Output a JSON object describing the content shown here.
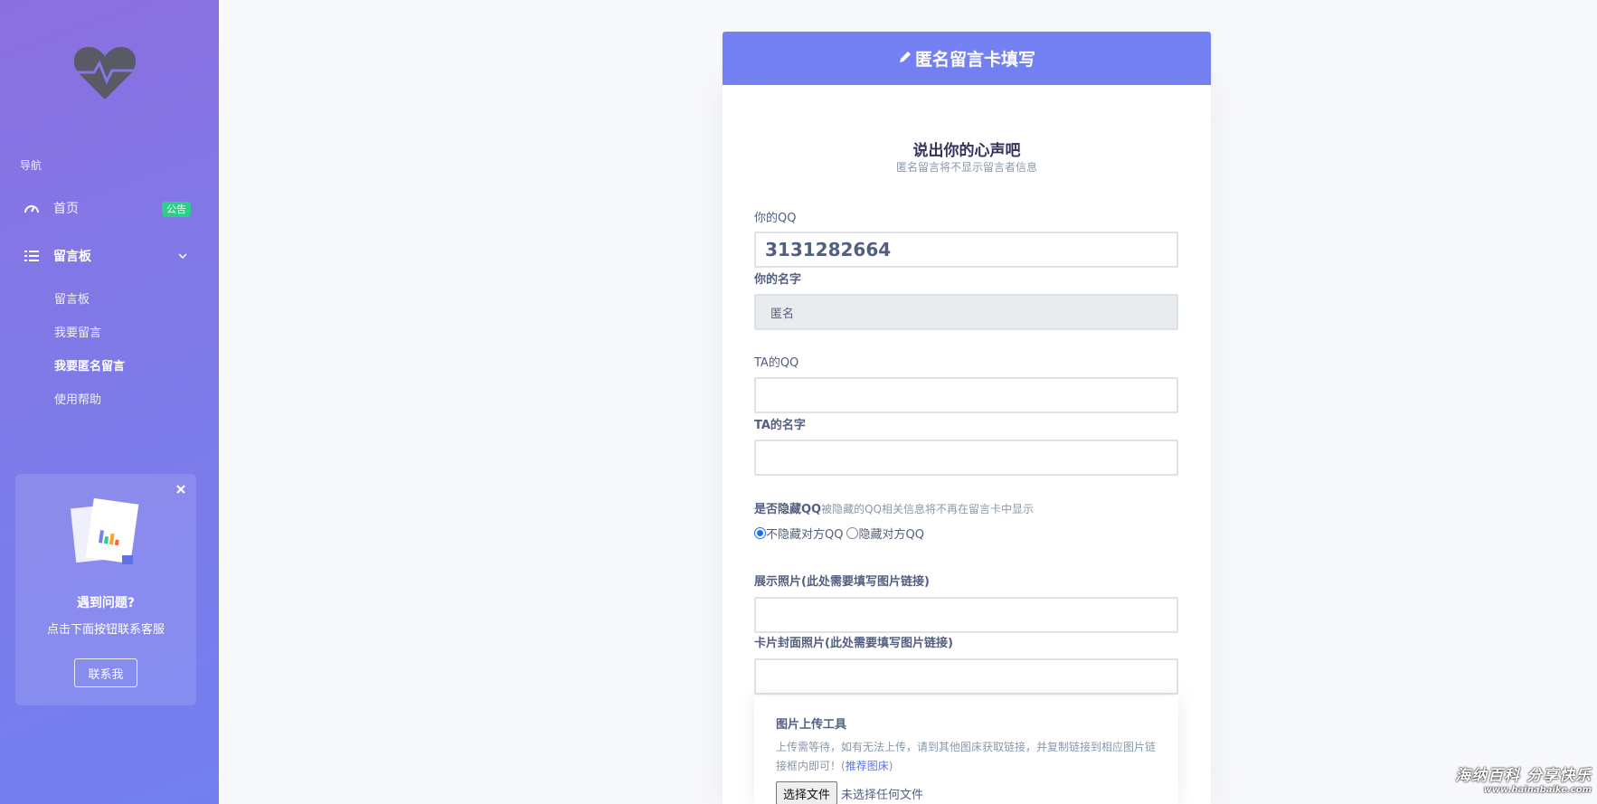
{
  "sidebar": {
    "nav_heading": "导航",
    "items": [
      {
        "label": "首页",
        "badge": "公告"
      },
      {
        "label": "留言板"
      }
    ],
    "sub_items": [
      "留言板",
      "我要留言",
      "我要匿名留言",
      "使用帮助"
    ],
    "help": {
      "title": "遇到问题?",
      "subtitle": "点击下面按钮联系客服",
      "button": "联系我"
    }
  },
  "card": {
    "header_title": "匿名留言卡填写",
    "form_title": "说出你的心声吧",
    "form_subtitle": "匿名留言将不显示留言者信息",
    "fields": {
      "your_qq_label": "你的QQ",
      "your_qq_value": "3131282664",
      "your_name_label": "你的名字",
      "your_name_value": "匿名",
      "ta_qq_label": "TA的QQ",
      "ta_name_label": "TA的名字",
      "hide_qq_label": "是否隐藏QQ",
      "hide_qq_hint": "被隐藏的QQ相关信息将不再在留言卡中显示",
      "radio_show": "不隐藏对方QQ",
      "radio_hide": "隐藏对方QQ",
      "photo_label": "展示照片(此处需要填写图片链接)",
      "cover_label": "卡片封面照片(此处需要填写图片链接)"
    },
    "upload": {
      "title": "图片上传工具",
      "desc": "上传需等待，如有无法上传，请到其他图床获取链接，并复制链接到相应图片链接框内即可！(",
      "link": "推荐图床",
      "desc_end": ")",
      "file_button": "选择文件",
      "file_status": "未选择任何文件"
    }
  },
  "watermark": {
    "line1": "海纳百科 分享快乐",
    "line2": "www.hainabaike.com"
  },
  "colors": {
    "sidebar": "#8b6fe0",
    "header": "#7381f3",
    "badge": "#2dce89"
  }
}
